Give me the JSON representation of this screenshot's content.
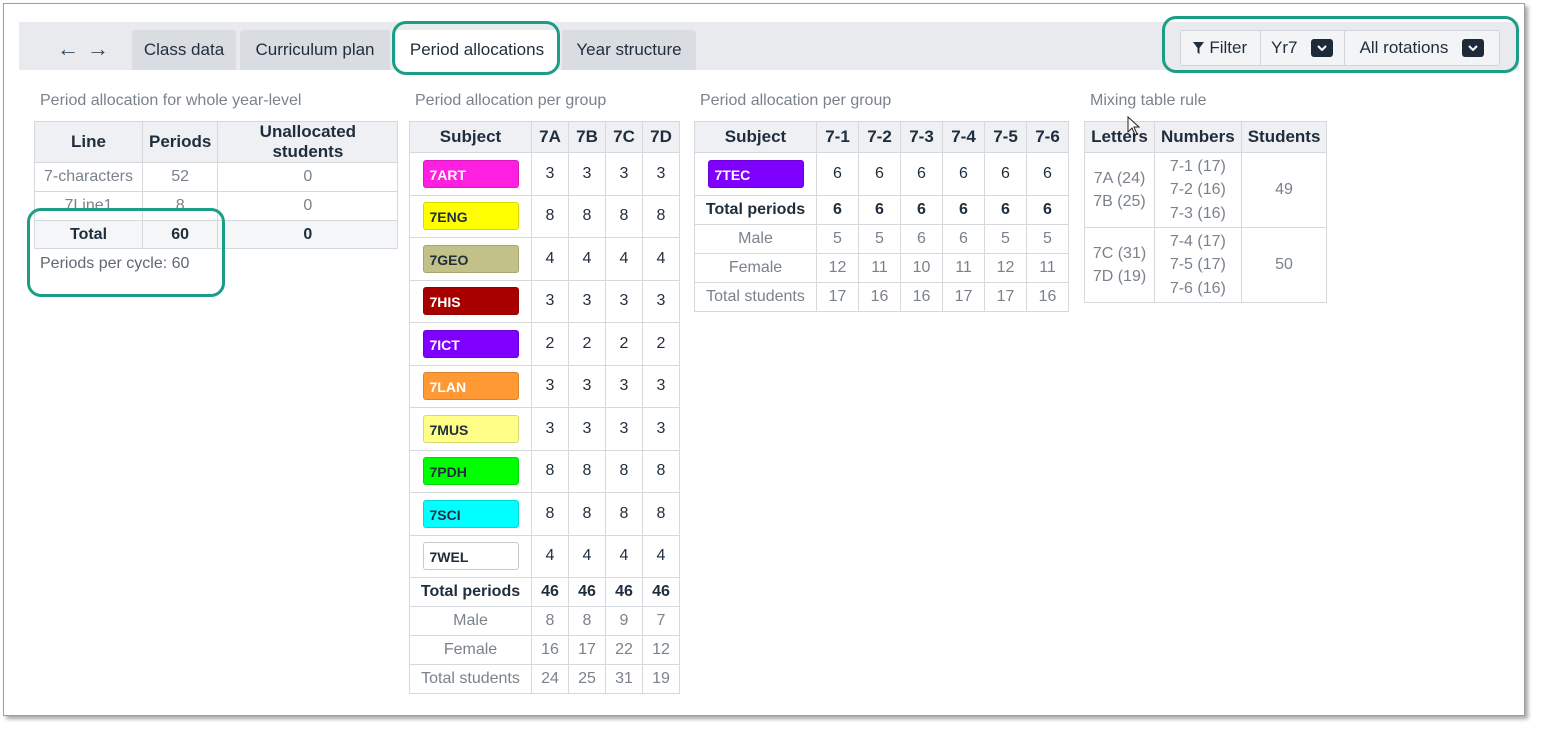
{
  "nav": {
    "back_icon": "arrow-left-icon",
    "forward_icon": "arrow-right-icon",
    "back_glyph": "←",
    "forward_glyph": "→"
  },
  "tabs": [
    {
      "label": "Class data",
      "active": false
    },
    {
      "label": "Curriculum plan",
      "active": false
    },
    {
      "label": "Period allocations",
      "active": true
    },
    {
      "label": "Year structure",
      "active": false
    }
  ],
  "toolbar": {
    "filter_label": "Filter",
    "filter_icon": "funnel-icon",
    "year_value": "Yr7",
    "rotation_value": "All rotations"
  },
  "whole_year": {
    "title": "Period allocation for whole year-level",
    "headers": [
      "Line",
      "Periods",
      "Unallocated students"
    ],
    "rows": [
      [
        "7-characters",
        "52",
        "0"
      ],
      [
        "7Line1",
        "8",
        "0"
      ]
    ],
    "total": [
      "Total",
      "60",
      "0"
    ],
    "periods_per_cycle_label": "Periods per cycle:",
    "periods_per_cycle_value": "60"
  },
  "per_group_1": {
    "title": "Period allocation per group",
    "headers": [
      "Subject",
      "7A",
      "7B",
      "7C",
      "7D"
    ],
    "subjects": [
      {
        "code": "7ART",
        "color": "#ff1fe0",
        "text_color": "#ffffff",
        "values": [
          "3",
          "3",
          "3",
          "3"
        ]
      },
      {
        "code": "7ENG",
        "color": "#ffff00",
        "text_color": "#1f2d3d",
        "values": [
          "8",
          "8",
          "8",
          "8"
        ]
      },
      {
        "code": "7GEO",
        "color": "#c2c187",
        "text_color": "#1f2d3d",
        "values": [
          "4",
          "4",
          "4",
          "4"
        ]
      },
      {
        "code": "7HIS",
        "color": "#a80000",
        "text_color": "#ffffff",
        "values": [
          "3",
          "3",
          "3",
          "3"
        ]
      },
      {
        "code": "7ICT",
        "color": "#8000ff",
        "text_color": "#ffffff",
        "values": [
          "2",
          "2",
          "2",
          "2"
        ]
      },
      {
        "code": "7LAN",
        "color": "#ff9933",
        "text_color": "#ffffff",
        "values": [
          "3",
          "3",
          "3",
          "3"
        ]
      },
      {
        "code": "7MUS",
        "color": "#ffff88",
        "text_color": "#1f2d3d",
        "values": [
          "3",
          "3",
          "3",
          "3"
        ]
      },
      {
        "code": "7PDH",
        "color": "#00ff00",
        "text_color": "#1f2d3d",
        "values": [
          "8",
          "8",
          "8",
          "8"
        ]
      },
      {
        "code": "7SCI",
        "color": "#00ffff",
        "text_color": "#1f2d3d",
        "values": [
          "8",
          "8",
          "8",
          "8"
        ]
      },
      {
        "code": "7WEL",
        "color": "#ffffff",
        "text_color": "#1f2d3d",
        "values": [
          "4",
          "4",
          "4",
          "4"
        ]
      }
    ],
    "total_periods": {
      "label": "Total periods",
      "values": [
        "46",
        "46",
        "46",
        "46"
      ]
    },
    "male": {
      "label": "Male",
      "values": [
        "8",
        "8",
        "9",
        "7"
      ]
    },
    "female": {
      "label": "Female",
      "values": [
        "16",
        "17",
        "22",
        "12"
      ]
    },
    "total_students": {
      "label": "Total students",
      "values": [
        "24",
        "25",
        "31",
        "19"
      ]
    }
  },
  "per_group_2": {
    "title": "Period allocation per group",
    "headers": [
      "Subject",
      "7-1",
      "7-2",
      "7-3",
      "7-4",
      "7-5",
      "7-6"
    ],
    "subjects": [
      {
        "code": "7TEC",
        "color": "#8000ff",
        "text_color": "#ffffff",
        "values": [
          "6",
          "6",
          "6",
          "6",
          "6",
          "6"
        ]
      }
    ],
    "total_periods": {
      "label": "Total periods",
      "values": [
        "6",
        "6",
        "6",
        "6",
        "6",
        "6"
      ]
    },
    "male": {
      "label": "Male",
      "values": [
        "5",
        "5",
        "6",
        "6",
        "5",
        "5"
      ]
    },
    "female": {
      "label": "Female",
      "values": [
        "12",
        "11",
        "10",
        "11",
        "12",
        "11"
      ]
    },
    "total_students": {
      "label": "Total students",
      "values": [
        "17",
        "16",
        "16",
        "17",
        "17",
        "16"
      ]
    }
  },
  "mixing": {
    "title": "Mixing table rule",
    "headers": [
      "Letters",
      "Numbers",
      "Students"
    ],
    "rows": [
      {
        "letters": [
          "7A (24)",
          "7B (25)"
        ],
        "numbers": [
          "7-1 (17)",
          "7-2 (16)",
          "7-3 (16)"
        ],
        "students": "49"
      },
      {
        "letters": [
          "7C (31)",
          "7D (19)"
        ],
        "numbers": [
          "7-4 (17)",
          "7-5 (17)",
          "7-6 (16)"
        ],
        "students": "50"
      }
    ]
  },
  "colors": {
    "highlight": "#1c9e86",
    "header_bg": "#eef0f3",
    "topbar_bg": "#e8eaed"
  }
}
